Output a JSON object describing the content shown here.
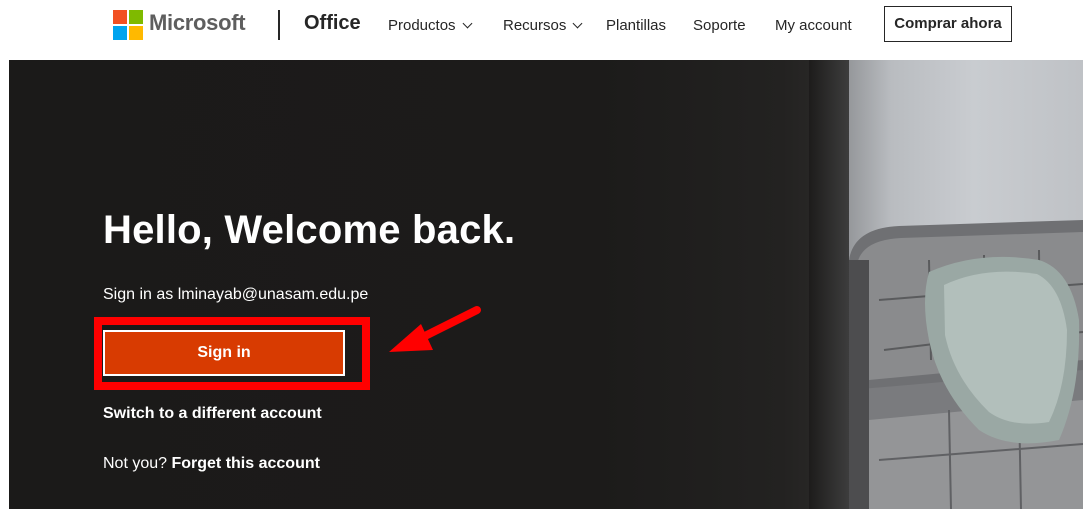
{
  "header": {
    "brand": "Microsoft",
    "product": "Office",
    "nav": [
      {
        "label": "Productos",
        "has_dropdown": true
      },
      {
        "label": "Recursos",
        "has_dropdown": true
      },
      {
        "label": "Plantillas",
        "has_dropdown": false
      },
      {
        "label": "Soporte",
        "has_dropdown": false
      },
      {
        "label": "My account",
        "has_dropdown": false
      }
    ],
    "buy_button": "Comprar ahora"
  },
  "hero": {
    "title": "Hello, Welcome back.",
    "signin_prefix": "Sign in as ",
    "email": "lminayab@unasam.edu.pe",
    "signin_button": "Sign in",
    "switch_account": "Switch to a different account",
    "not_you": "Not you? ",
    "forget_account": "Forget this account"
  },
  "colors": {
    "accent": "#d83b01",
    "annotation": "#ff0000",
    "hero_bg": "#1b1a19"
  },
  "icons": [
    "microsoft-logo",
    "chevron-down-icon",
    "annotation-arrow"
  ]
}
